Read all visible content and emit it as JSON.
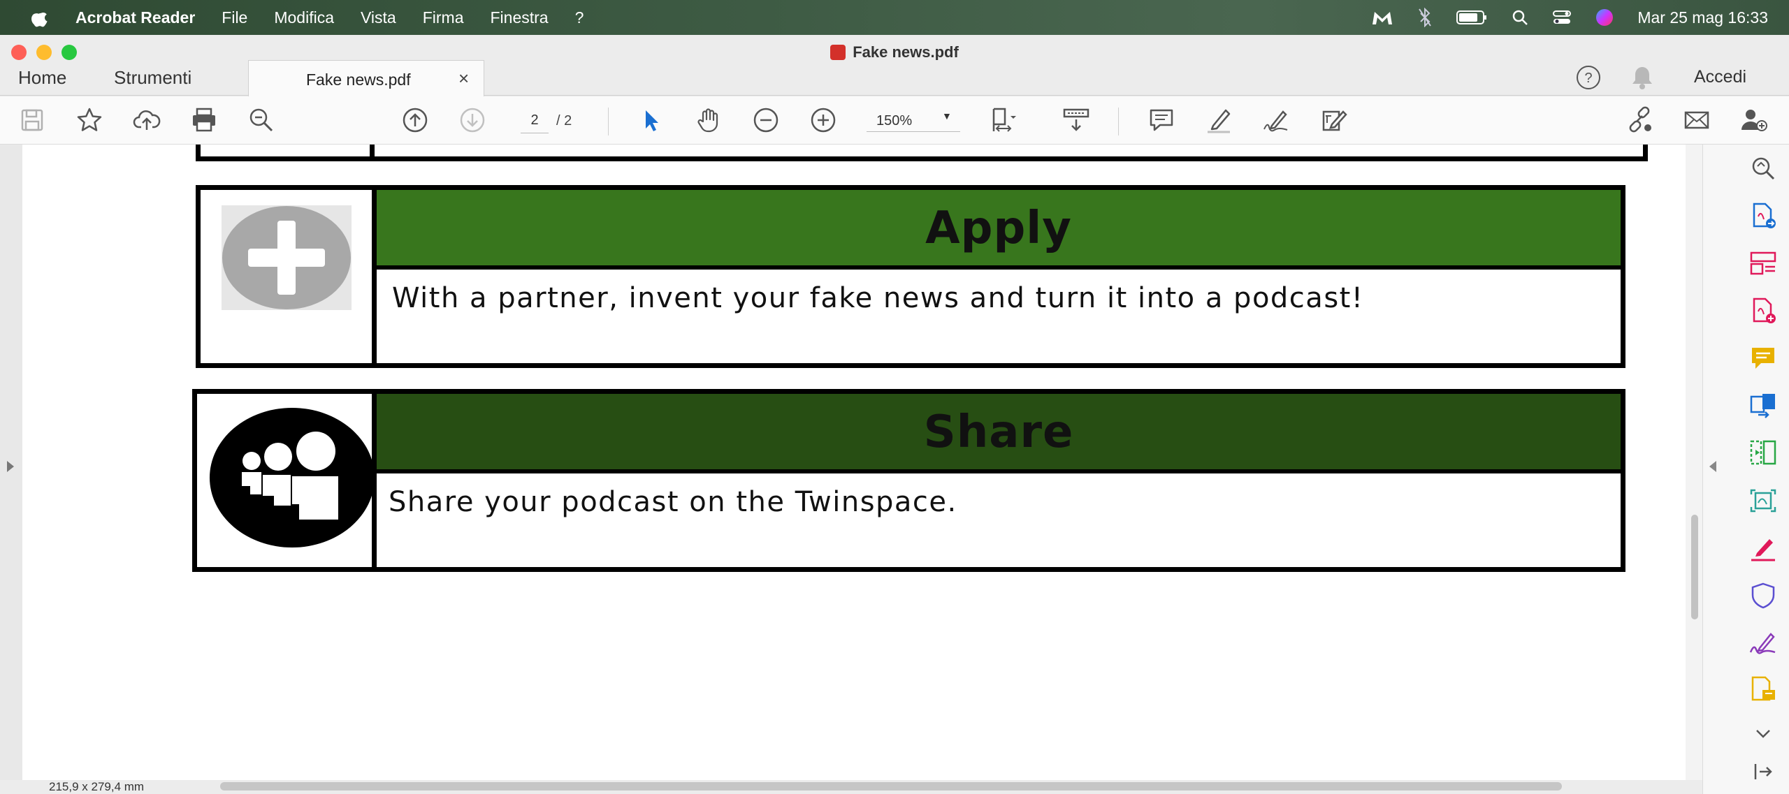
{
  "menubar": {
    "app": "Acrobat Reader",
    "items": [
      "File",
      "Modifica",
      "Vista",
      "Firma",
      "Finestra",
      "?"
    ],
    "datetime": "Mar 25 mag 16:33"
  },
  "window": {
    "title": "Fake news.pdf",
    "tabs": {
      "home": "Home",
      "tools": "Strumenti",
      "document": "Fake news.pdf",
      "close": "×"
    },
    "signin": "Accedi"
  },
  "toolbar": {
    "page_current": "2",
    "page_total": "/ 2",
    "zoom": "150%"
  },
  "document": {
    "sections": [
      {
        "title": "Apply",
        "text": "With a partner, invent your fake news and turn it into a podcast!",
        "header_color": "#38761d"
      },
      {
        "title": "Share",
        "text": "Share your podcast on the Twinspace.",
        "header_color": "#274e13"
      }
    ]
  },
  "status": {
    "page_size": "215,9 x 279,4 mm"
  },
  "colors": {
    "accent_blue": "#1a6fd1",
    "tool_pink": "#e0195a",
    "tool_purple": "#8a3ab9",
    "tool_teal": "#2aa198",
    "tool_yellow": "#e8b100"
  }
}
